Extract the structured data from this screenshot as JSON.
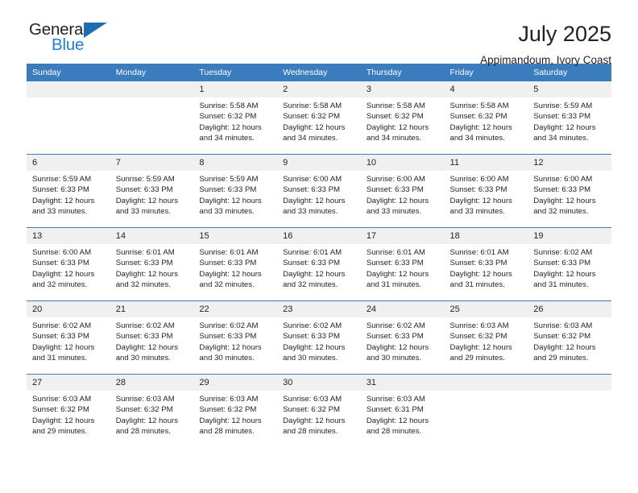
{
  "logo": {
    "name_top": "General",
    "name_bottom": "Blue",
    "triangle_color": "#1f6cb0",
    "blue_color": "#1f7fd0"
  },
  "header": {
    "title": "July 2025",
    "subtitle": "Appimandoum, Ivory Coast"
  },
  "theme": {
    "header_bg": "#3a7cbe",
    "daynum_bg": "#f0f0f0",
    "text": "#231f20"
  },
  "weekdays": [
    "Sunday",
    "Monday",
    "Tuesday",
    "Wednesday",
    "Thursday",
    "Friday",
    "Saturday"
  ],
  "labels": {
    "sunrise_prefix": "Sunrise:",
    "sunset_prefix": "Sunset:",
    "daylight_prefix": "Daylight:"
  },
  "weeks": [
    [
      {
        "day": "",
        "empty": true
      },
      {
        "day": "",
        "empty": true
      },
      {
        "day": "1",
        "sunrise": "Sunrise: 5:58 AM",
        "sunset": "Sunset: 6:32 PM",
        "daylight": "Daylight: 12 hours and 34 minutes."
      },
      {
        "day": "2",
        "sunrise": "Sunrise: 5:58 AM",
        "sunset": "Sunset: 6:32 PM",
        "daylight": "Daylight: 12 hours and 34 minutes."
      },
      {
        "day": "3",
        "sunrise": "Sunrise: 5:58 AM",
        "sunset": "Sunset: 6:32 PM",
        "daylight": "Daylight: 12 hours and 34 minutes."
      },
      {
        "day": "4",
        "sunrise": "Sunrise: 5:58 AM",
        "sunset": "Sunset: 6:32 PM",
        "daylight": "Daylight: 12 hours and 34 minutes."
      },
      {
        "day": "5",
        "sunrise": "Sunrise: 5:59 AM",
        "sunset": "Sunset: 6:33 PM",
        "daylight": "Daylight: 12 hours and 34 minutes."
      }
    ],
    [
      {
        "day": "6",
        "sunrise": "Sunrise: 5:59 AM",
        "sunset": "Sunset: 6:33 PM",
        "daylight": "Daylight: 12 hours and 33 minutes."
      },
      {
        "day": "7",
        "sunrise": "Sunrise: 5:59 AM",
        "sunset": "Sunset: 6:33 PM",
        "daylight": "Daylight: 12 hours and 33 minutes."
      },
      {
        "day": "8",
        "sunrise": "Sunrise: 5:59 AM",
        "sunset": "Sunset: 6:33 PM",
        "daylight": "Daylight: 12 hours and 33 minutes."
      },
      {
        "day": "9",
        "sunrise": "Sunrise: 6:00 AM",
        "sunset": "Sunset: 6:33 PM",
        "daylight": "Daylight: 12 hours and 33 minutes."
      },
      {
        "day": "10",
        "sunrise": "Sunrise: 6:00 AM",
        "sunset": "Sunset: 6:33 PM",
        "daylight": "Daylight: 12 hours and 33 minutes."
      },
      {
        "day": "11",
        "sunrise": "Sunrise: 6:00 AM",
        "sunset": "Sunset: 6:33 PM",
        "daylight": "Daylight: 12 hours and 33 minutes."
      },
      {
        "day": "12",
        "sunrise": "Sunrise: 6:00 AM",
        "sunset": "Sunset: 6:33 PM",
        "daylight": "Daylight: 12 hours and 32 minutes."
      }
    ],
    [
      {
        "day": "13",
        "sunrise": "Sunrise: 6:00 AM",
        "sunset": "Sunset: 6:33 PM",
        "daylight": "Daylight: 12 hours and 32 minutes."
      },
      {
        "day": "14",
        "sunrise": "Sunrise: 6:01 AM",
        "sunset": "Sunset: 6:33 PM",
        "daylight": "Daylight: 12 hours and 32 minutes."
      },
      {
        "day": "15",
        "sunrise": "Sunrise: 6:01 AM",
        "sunset": "Sunset: 6:33 PM",
        "daylight": "Daylight: 12 hours and 32 minutes."
      },
      {
        "day": "16",
        "sunrise": "Sunrise: 6:01 AM",
        "sunset": "Sunset: 6:33 PM",
        "daylight": "Daylight: 12 hours and 32 minutes."
      },
      {
        "day": "17",
        "sunrise": "Sunrise: 6:01 AM",
        "sunset": "Sunset: 6:33 PM",
        "daylight": "Daylight: 12 hours and 31 minutes."
      },
      {
        "day": "18",
        "sunrise": "Sunrise: 6:01 AM",
        "sunset": "Sunset: 6:33 PM",
        "daylight": "Daylight: 12 hours and 31 minutes."
      },
      {
        "day": "19",
        "sunrise": "Sunrise: 6:02 AM",
        "sunset": "Sunset: 6:33 PM",
        "daylight": "Daylight: 12 hours and 31 minutes."
      }
    ],
    [
      {
        "day": "20",
        "sunrise": "Sunrise: 6:02 AM",
        "sunset": "Sunset: 6:33 PM",
        "daylight": "Daylight: 12 hours and 31 minutes."
      },
      {
        "day": "21",
        "sunrise": "Sunrise: 6:02 AM",
        "sunset": "Sunset: 6:33 PM",
        "daylight": "Daylight: 12 hours and 30 minutes."
      },
      {
        "day": "22",
        "sunrise": "Sunrise: 6:02 AM",
        "sunset": "Sunset: 6:33 PM",
        "daylight": "Daylight: 12 hours and 30 minutes."
      },
      {
        "day": "23",
        "sunrise": "Sunrise: 6:02 AM",
        "sunset": "Sunset: 6:33 PM",
        "daylight": "Daylight: 12 hours and 30 minutes."
      },
      {
        "day": "24",
        "sunrise": "Sunrise: 6:02 AM",
        "sunset": "Sunset: 6:33 PM",
        "daylight": "Daylight: 12 hours and 30 minutes."
      },
      {
        "day": "25",
        "sunrise": "Sunrise: 6:03 AM",
        "sunset": "Sunset: 6:32 PM",
        "daylight": "Daylight: 12 hours and 29 minutes."
      },
      {
        "day": "26",
        "sunrise": "Sunrise: 6:03 AM",
        "sunset": "Sunset: 6:32 PM",
        "daylight": "Daylight: 12 hours and 29 minutes."
      }
    ],
    [
      {
        "day": "27",
        "sunrise": "Sunrise: 6:03 AM",
        "sunset": "Sunset: 6:32 PM",
        "daylight": "Daylight: 12 hours and 29 minutes."
      },
      {
        "day": "28",
        "sunrise": "Sunrise: 6:03 AM",
        "sunset": "Sunset: 6:32 PM",
        "daylight": "Daylight: 12 hours and 28 minutes."
      },
      {
        "day": "29",
        "sunrise": "Sunrise: 6:03 AM",
        "sunset": "Sunset: 6:32 PM",
        "daylight": "Daylight: 12 hours and 28 minutes."
      },
      {
        "day": "30",
        "sunrise": "Sunrise: 6:03 AM",
        "sunset": "Sunset: 6:32 PM",
        "daylight": "Daylight: 12 hours and 28 minutes."
      },
      {
        "day": "31",
        "sunrise": "Sunrise: 6:03 AM",
        "sunset": "Sunset: 6:31 PM",
        "daylight": "Daylight: 12 hours and 28 minutes."
      },
      {
        "day": "",
        "empty": true
      },
      {
        "day": "",
        "empty": true
      }
    ]
  ]
}
